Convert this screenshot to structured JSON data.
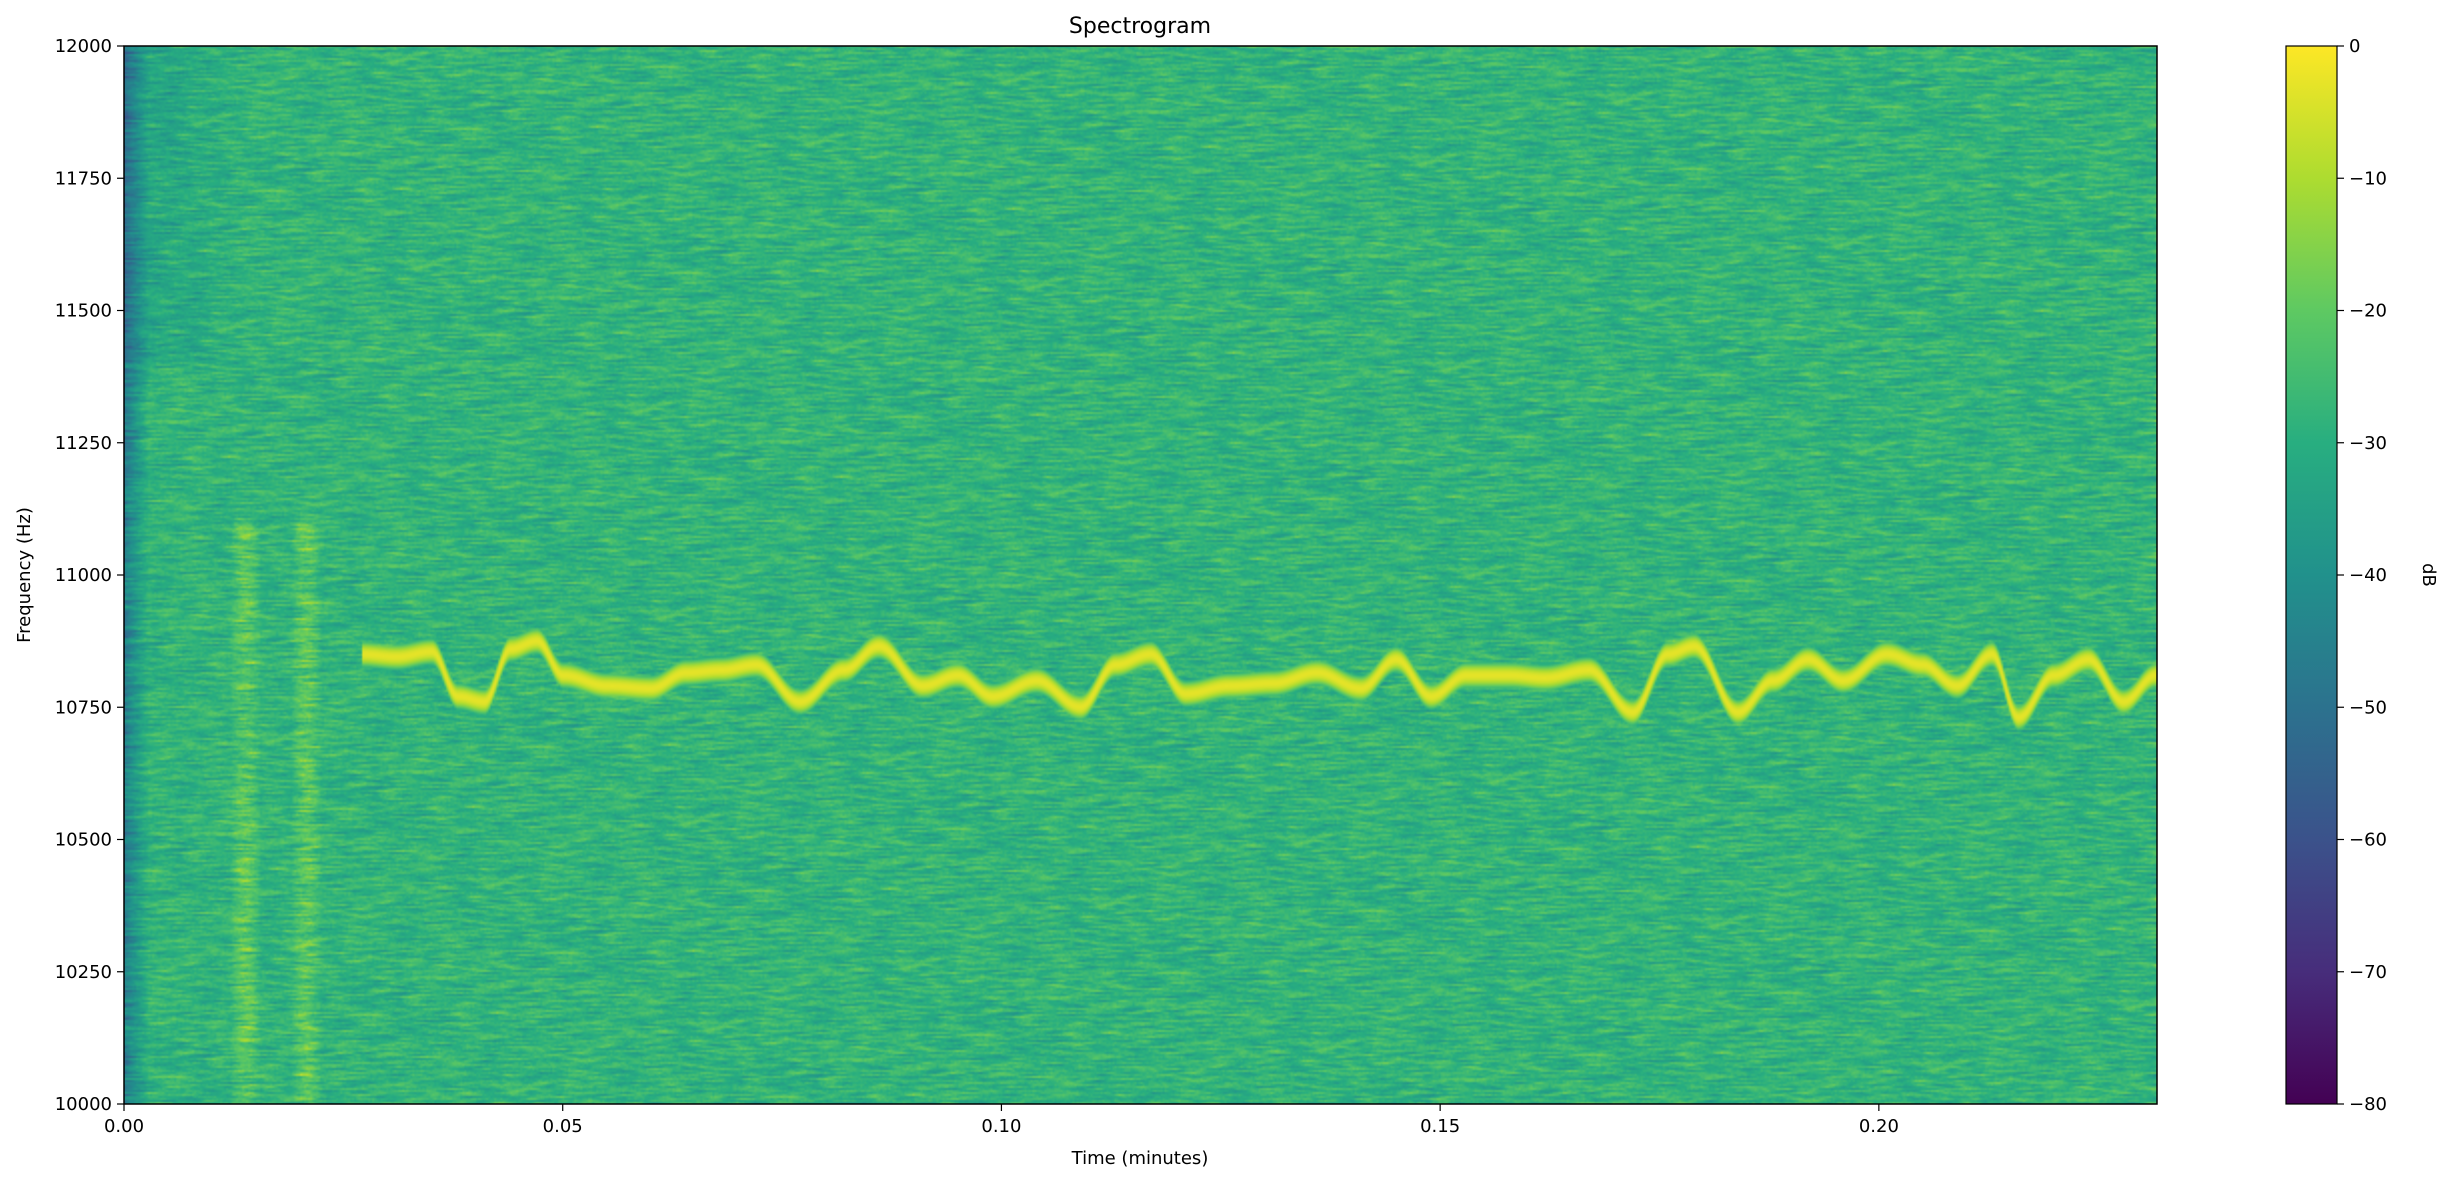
{
  "chart_data": {
    "type": "heatmap",
    "title": "Spectrogram",
    "xlabel": "Time (minutes)",
    "ylabel": "Frequency (Hz)",
    "xlim": [
      0.0,
      0.2317
    ],
    "ylim": [
      10000,
      12000
    ],
    "x_ticks": [
      "0.00",
      "0.05",
      "0.10",
      "0.15",
      "0.20"
    ],
    "x_tick_values": [
      0.0,
      0.05,
      0.1,
      0.15,
      0.2
    ],
    "y_ticks": [
      "10000",
      "10250",
      "10500",
      "10750",
      "11000",
      "11250",
      "11500",
      "11750",
      "12000"
    ],
    "y_tick_values": [
      10000,
      10250,
      10500,
      10750,
      11000,
      11250,
      11500,
      11750,
      12000
    ],
    "grid": false,
    "colormap": "viridis",
    "colorbar": {
      "label": "dB",
      "range": [
        -80,
        0
      ],
      "ticks": [
        "0",
        "−10",
        "−20",
        "−30",
        "−40",
        "−50",
        "−60",
        "−70",
        "−80"
      ],
      "tick_values": [
        0,
        -10,
        -20,
        -30,
        -40,
        -50,
        -60,
        -70,
        -80
      ]
    },
    "background_level_db": -28,
    "dominant_tone": {
      "description_values": "time (minutes) vs frequency (Hz)",
      "points": [
        [
          0.027,
          10850
        ],
        [
          0.031,
          10845
        ],
        [
          0.035,
          10855
        ],
        [
          0.038,
          10770
        ],
        [
          0.041,
          10760
        ],
        [
          0.044,
          10860
        ],
        [
          0.047,
          10875
        ],
        [
          0.05,
          10810
        ],
        [
          0.055,
          10790
        ],
        [
          0.06,
          10785
        ],
        [
          0.064,
          10815
        ],
        [
          0.068,
          10820
        ],
        [
          0.072,
          10830
        ],
        [
          0.077,
          10760
        ],
        [
          0.082,
          10820
        ],
        [
          0.086,
          10865
        ],
        [
          0.091,
          10790
        ],
        [
          0.095,
          10810
        ],
        [
          0.099,
          10770
        ],
        [
          0.104,
          10800
        ],
        [
          0.109,
          10750
        ],
        [
          0.113,
          10830
        ],
        [
          0.117,
          10850
        ],
        [
          0.121,
          10775
        ],
        [
          0.126,
          10790
        ],
        [
          0.131,
          10795
        ],
        [
          0.136,
          10815
        ],
        [
          0.141,
          10785
        ],
        [
          0.145,
          10840
        ],
        [
          0.149,
          10770
        ],
        [
          0.153,
          10810
        ],
        [
          0.158,
          10810
        ],
        [
          0.162,
          10805
        ],
        [
          0.167,
          10820
        ],
        [
          0.172,
          10740
        ],
        [
          0.176,
          10850
        ],
        [
          0.179,
          10865
        ],
        [
          0.184,
          10740
        ],
        [
          0.188,
          10800
        ],
        [
          0.192,
          10840
        ],
        [
          0.196,
          10800
        ],
        [
          0.201,
          10850
        ],
        [
          0.205,
          10830
        ],
        [
          0.209,
          10790
        ],
        [
          0.213,
          10850
        ],
        [
          0.216,
          10730
        ],
        [
          0.22,
          10810
        ],
        [
          0.224,
          10840
        ],
        [
          0.228,
          10760
        ],
        [
          0.2317,
          10810
        ]
      ],
      "peak_level_db": -3
    }
  }
}
